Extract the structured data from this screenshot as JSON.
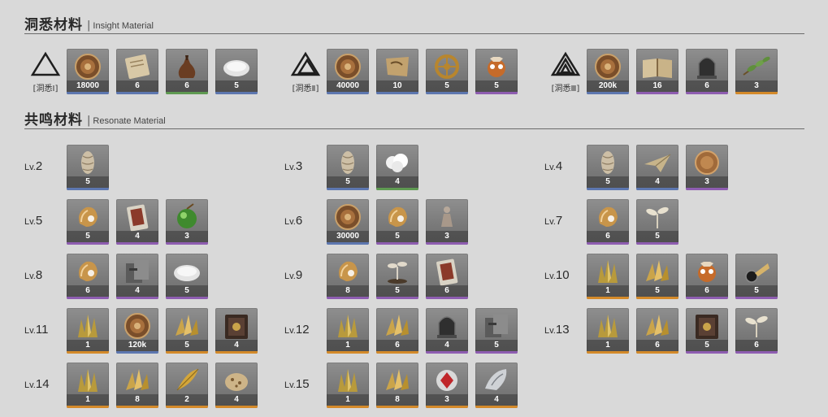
{
  "insight": {
    "title_zh": "洞悉材料",
    "separator": "|",
    "title_en": "Insight Material",
    "tiers": [
      {
        "label": "[洞悉Ⅰ]",
        "icon": "triangle-tier1-icon",
        "items": [
          {
            "name": "coin-icon",
            "count": "18000",
            "rarity": "b"
          },
          {
            "name": "scroll-icon",
            "count": "6",
            "rarity": "b"
          },
          {
            "name": "pouch-icon",
            "count": "6",
            "rarity": "gr"
          },
          {
            "name": "silver-dish-icon",
            "count": "5",
            "rarity": "b"
          }
        ]
      },
      {
        "label": "[洞悉Ⅱ]",
        "icon": "triangle-tier2-icon",
        "items": [
          {
            "name": "coin-icon",
            "count": "40000",
            "rarity": "b"
          },
          {
            "name": "map-icon",
            "count": "10",
            "rarity": "b"
          },
          {
            "name": "gear-wheel-icon",
            "count": "5",
            "rarity": "b"
          },
          {
            "name": "owl-figure-icon",
            "count": "5",
            "rarity": "p"
          }
        ]
      },
      {
        "label": "[洞悉Ⅲ]",
        "icon": "triangle-tier3-icon",
        "items": [
          {
            "name": "coin-icon",
            "count": "200k",
            "rarity": "b"
          },
          {
            "name": "book-icon",
            "count": "16",
            "rarity": "p"
          },
          {
            "name": "glass-dome-icon",
            "count": "6",
            "rarity": "p"
          },
          {
            "name": "leaf-branch-icon",
            "count": "3",
            "rarity": "o"
          }
        ]
      }
    ]
  },
  "resonate": {
    "title_zh": "共鸣材料",
    "separator": "|",
    "title_en": "Resonate Material",
    "levels": [
      {
        "prefix": "Lv.",
        "num": "2",
        "items": [
          {
            "name": "pinecone-icon",
            "count": "5",
            "rarity": "b"
          }
        ]
      },
      {
        "prefix": "Lv.",
        "num": "3",
        "items": [
          {
            "name": "pinecone-icon",
            "count": "5",
            "rarity": "b"
          },
          {
            "name": "cotton-icon",
            "count": "4",
            "rarity": "gr"
          }
        ]
      },
      {
        "prefix": "Lv.",
        "num": "4",
        "items": [
          {
            "name": "pinecone-icon",
            "count": "5",
            "rarity": "b"
          },
          {
            "name": "paper-plane-icon",
            "count": "4",
            "rarity": "b"
          },
          {
            "name": "bronze-medal-icon",
            "count": "3",
            "rarity": "p"
          }
        ]
      },
      {
        "prefix": "Lv.",
        "num": "5",
        "items": [
          {
            "name": "amber-stone-icon",
            "count": "5",
            "rarity": "p"
          },
          {
            "name": "card-icon",
            "count": "4",
            "rarity": "p"
          },
          {
            "name": "green-orb-icon",
            "count": "3",
            "rarity": "p"
          }
        ]
      },
      {
        "prefix": "Lv.",
        "num": "6",
        "items": [
          {
            "name": "coin-icon",
            "count": "30000",
            "rarity": "b"
          },
          {
            "name": "amber-stone-icon",
            "count": "5",
            "rarity": "p"
          },
          {
            "name": "figurine-icon",
            "count": "3",
            "rarity": "p"
          }
        ]
      },
      {
        "prefix": "Lv.",
        "num": "7",
        "items": [
          {
            "name": "amber-stone-icon",
            "count": "6",
            "rarity": "p"
          },
          {
            "name": "sprout-icon",
            "count": "5",
            "rarity": "p"
          }
        ]
      },
      {
        "prefix": "Lv.",
        "num": "8",
        "items": [
          {
            "name": "amber-stone-icon",
            "count": "6",
            "rarity": "p"
          },
          {
            "name": "metal-block-icon",
            "count": "4",
            "rarity": "p"
          },
          {
            "name": "silver-dish-icon",
            "count": "5",
            "rarity": "p"
          }
        ]
      },
      {
        "prefix": "Lv.",
        "num": "9",
        "items": [
          {
            "name": "amber-stone-icon",
            "count": "8",
            "rarity": "p"
          },
          {
            "name": "plant-pot-icon",
            "count": "5",
            "rarity": "p"
          },
          {
            "name": "card-icon",
            "count": "6",
            "rarity": "p"
          }
        ]
      },
      {
        "prefix": "Lv.",
        "num": "10",
        "items": [
          {
            "name": "gold-crystal-icon",
            "count": "1",
            "rarity": "o"
          },
          {
            "name": "gold-shards-icon",
            "count": "5",
            "rarity": "o"
          },
          {
            "name": "owl-figure-icon",
            "count": "6",
            "rarity": "p"
          },
          {
            "name": "eye-brooch-icon",
            "count": "5",
            "rarity": "p"
          }
        ]
      },
      {
        "prefix": "Lv.",
        "num": "11",
        "items": [
          {
            "name": "gold-crystal-icon",
            "count": "1",
            "rarity": "o"
          },
          {
            "name": "coin-icon",
            "count": "120k",
            "rarity": "b"
          },
          {
            "name": "gold-shards-icon",
            "count": "5",
            "rarity": "o"
          },
          {
            "name": "dark-tome-icon",
            "count": "4",
            "rarity": "o"
          }
        ]
      },
      {
        "prefix": "Lv.",
        "num": "12",
        "items": [
          {
            "name": "gold-crystal-icon",
            "count": "1",
            "rarity": "o"
          },
          {
            "name": "gold-shards-icon",
            "count": "6",
            "rarity": "o"
          },
          {
            "name": "glass-dome-icon",
            "count": "4",
            "rarity": "p"
          },
          {
            "name": "metal-block-icon",
            "count": "5",
            "rarity": "p"
          }
        ]
      },
      {
        "prefix": "Lv.",
        "num": "13",
        "items": [
          {
            "name": "gold-crystal-icon",
            "count": "1",
            "rarity": "o"
          },
          {
            "name": "gold-shards-icon",
            "count": "6",
            "rarity": "o"
          },
          {
            "name": "dark-tome-icon",
            "count": "5",
            "rarity": "p"
          },
          {
            "name": "sprout-icon",
            "count": "6",
            "rarity": "p"
          }
        ]
      },
      {
        "prefix": "Lv.",
        "num": "14",
        "items": [
          {
            "name": "gold-crystal-icon",
            "count": "1",
            "rarity": "o"
          },
          {
            "name": "gold-shards-icon",
            "count": "8",
            "rarity": "o"
          },
          {
            "name": "gold-feather-icon",
            "count": "2",
            "rarity": "o"
          },
          {
            "name": "cookie-icon",
            "count": "4",
            "rarity": "o"
          }
        ]
      },
      {
        "prefix": "Lv.",
        "num": "15",
        "items": [
          {
            "name": "gold-crystal-icon",
            "count": "1",
            "rarity": "o"
          },
          {
            "name": "gold-shards-icon",
            "count": "8",
            "rarity": "o"
          },
          {
            "name": "red-gem-icon",
            "count": "3",
            "rarity": "o"
          },
          {
            "name": "silver-wing-icon",
            "count": "4",
            "rarity": "o"
          }
        ]
      }
    ]
  }
}
